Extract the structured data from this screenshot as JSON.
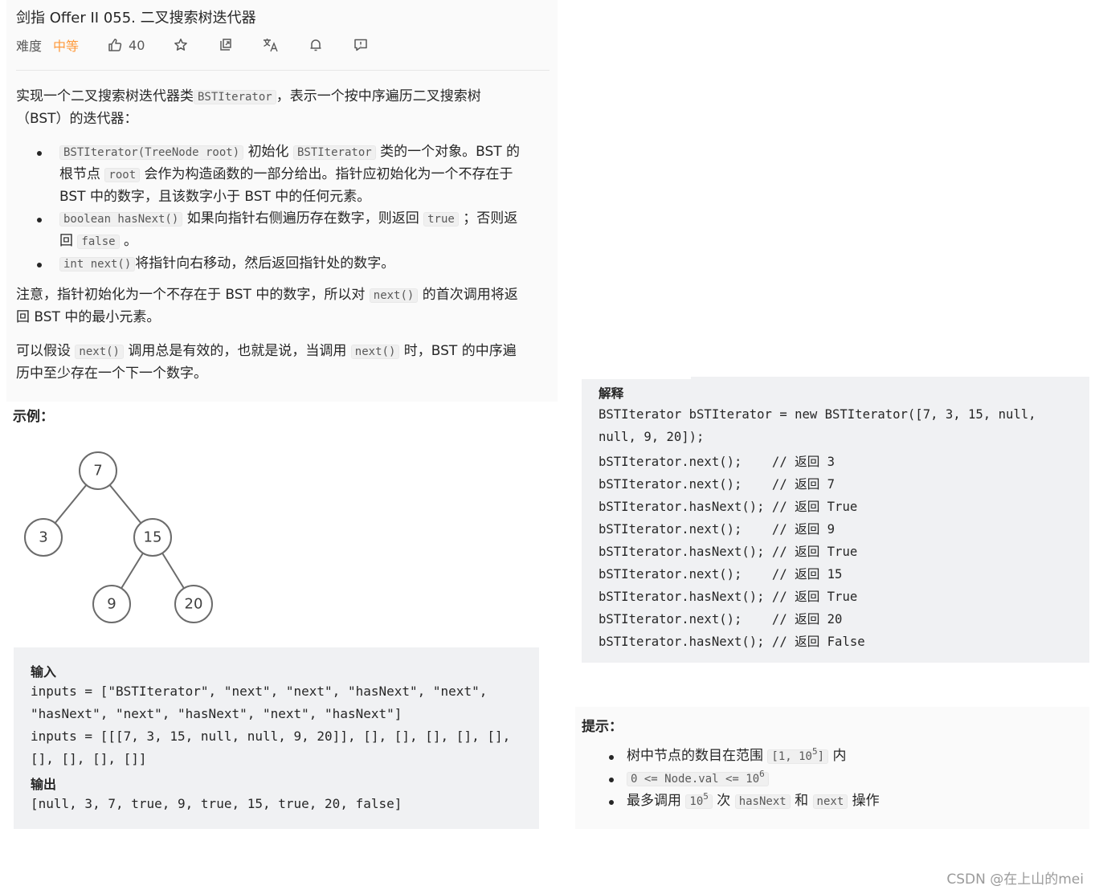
{
  "problem": {
    "title": "剑指 Offer II 055. 二叉搜索树迭代器",
    "difficulty_label": "难度",
    "difficulty_value": "中等",
    "likes": "40",
    "icons": [
      "thumbs-up-icon",
      "star-icon",
      "share-icon",
      "translate-icon",
      "bell-icon",
      "feedback-icon"
    ],
    "difficulty_color": "#ff9a3c"
  },
  "description": {
    "intro_pre": "实现一个二叉搜索树迭代器类",
    "intro_code": "BSTIterator",
    "intro_post_line1": "，表示一个按中序遍历二叉搜索树",
    "intro_line2": "（BST）的迭代器：",
    "bullets": [
      {
        "code1": "BSTIterator(TreeNode root)",
        "text1": "初始化",
        "code2": "BSTIterator",
        "text2": "类的一个对象。BST 的",
        "line2_pre": "根节点",
        "code3": "root",
        "line2_post": "会作为构造函数的一部分给出。指针应初始化为一个不存在于",
        "line3": "BST 中的数字，且该数字小于 BST 中的任何元素。"
      },
      {
        "code1": "boolean hasNext()",
        "text1": "如果向指针右侧遍历存在数字，则返回",
        "code2": "true",
        "text2": "；否则返",
        "line2_pre": "回",
        "code3": "false",
        "line2_post": "。"
      },
      {
        "code1": "int next()",
        "text1": "将指针向右移动，然后返回指针处的数字。"
      }
    ],
    "note1_pre": "注意，指针初始化为一个不存在于 BST 中的数字，所以对",
    "note1_code": "next()",
    "note1_post": "的首次调用将返",
    "note1_line2": "回 BST 中的最小元素。",
    "note2_pre": "可以假设",
    "note2_code1": "next()",
    "note2_mid": "调用总是有效的，也就是说，当调用",
    "note2_code2": "next()",
    "note2_post": "时，BST 的中序遍",
    "note2_line2": "历中至少存在一个下一个数字。"
  },
  "example": {
    "title": "示例：",
    "tree_nodes": [
      "7",
      "3",
      "15",
      "9",
      "20"
    ],
    "input_heading": "输入",
    "input_lines": [
      "inputs = [\"BSTIterator\", \"next\", \"next\", \"hasNext\", \"next\",",
      "\"hasNext\", \"next\", \"hasNext\", \"next\", \"hasNext\"]",
      "inputs = [[[7, 3, 15, null, null, 9, 20]], [], [], [], [], [],",
      "[], [], [], []]"
    ],
    "output_heading": "输出",
    "output_line": "[null, 3, 7, true, 9, true, 15, true, 20, false]"
  },
  "explanation": {
    "heading": "解释",
    "lines": [
      "BSTIterator bSTIterator = new BSTIterator([7, 3, 15, null,",
      "null, 9, 20]);",
      "bSTIterator.next();    // 返回 3",
      "bSTIterator.next();    // 返回 7",
      "bSTIterator.hasNext(); // 返回 True",
      "bSTIterator.next();    // 返回 9",
      "bSTIterator.hasNext(); // 返回 True",
      "bSTIterator.next();    // 返回 15",
      "bSTIterator.hasNext(); // 返回 True",
      "bSTIterator.next();    // 返回 20",
      "bSTIterator.hasNext(); // 返回 False"
    ]
  },
  "hints": {
    "title": "提示：",
    "h1_pre": "树中节点的数目在范围",
    "h1_code": "[1, 10",
    "h1_sup": "5",
    "h1_code_end": "]",
    "h1_post": "内",
    "h2_code": "0 <= Node.val <= 10",
    "h2_sup": "6",
    "h3_pre": "最多调用",
    "h3_code1": "10",
    "h3_sup": "5",
    "h3_mid": "次",
    "h3_code2": "hasNext",
    "h3_and": "和",
    "h3_code3": "next",
    "h3_post": "操作"
  },
  "watermark": "CSDN @在上山的mei"
}
